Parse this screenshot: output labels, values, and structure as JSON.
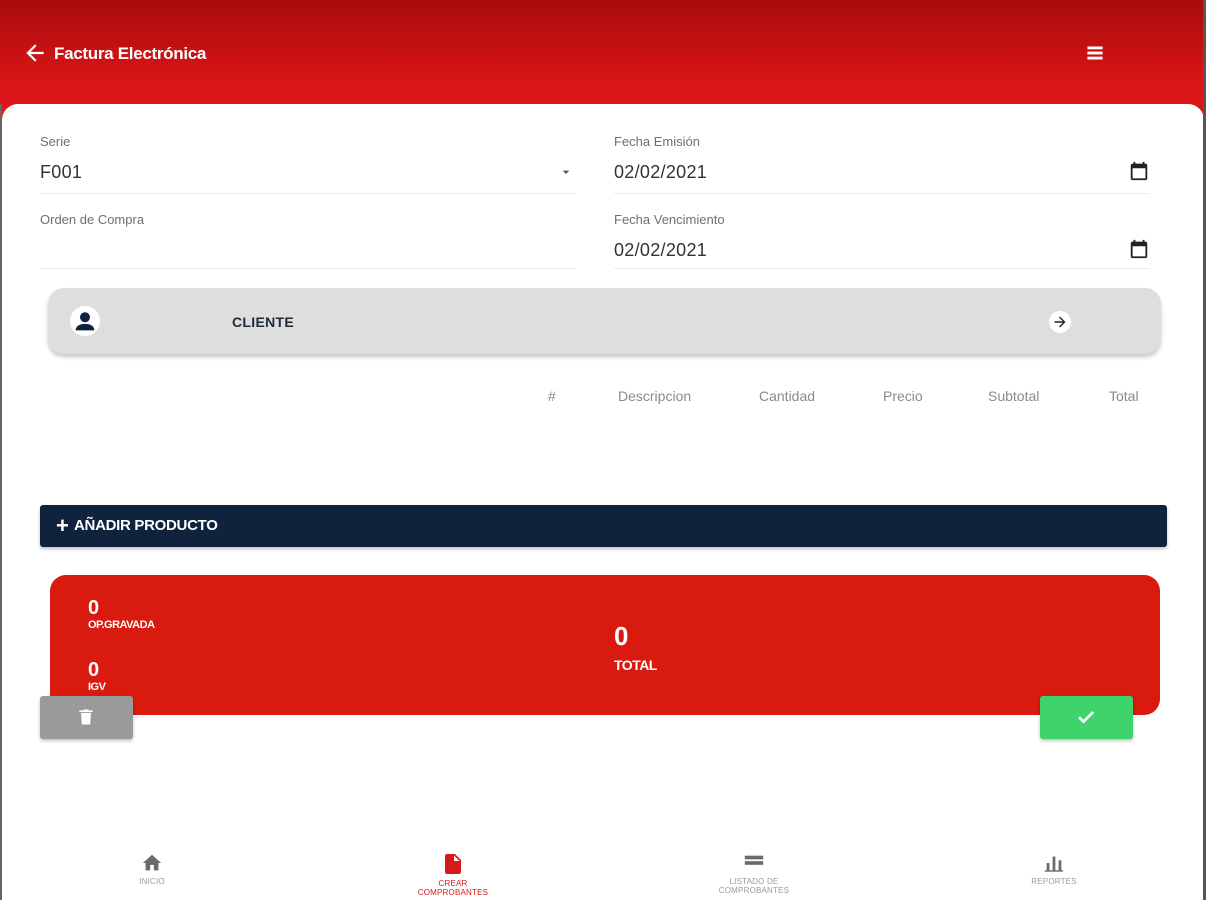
{
  "colors": {
    "header_red": "#d41416",
    "navy": "#0f233d",
    "totals_red": "#d81a0f",
    "confirm_green": "#3fd46b",
    "delete_gray": "#9a9a9a",
    "active_nav": "#d51a1a"
  },
  "header": {
    "title": "Factura Electrónica",
    "back_icon": "arrow-left-icon",
    "menu_icon": "hamburger-menu-icon"
  },
  "form": {
    "serie": {
      "label": "Serie",
      "value": "F001",
      "icon": "dropdown-caret-icon"
    },
    "fecha_emision": {
      "label": "Fecha Emisión",
      "value": "02/02/2021",
      "icon": "calendar-icon"
    },
    "orden_compra": {
      "label": "Orden de Compra",
      "value": ""
    },
    "fecha_vencimiento": {
      "label": "Fecha Vencimiento",
      "value": "02/02/2021",
      "icon": "calendar-icon"
    }
  },
  "cliente": {
    "label": "CLIENTE",
    "icon": "user-icon",
    "action_icon": "arrow-right-circle-icon"
  },
  "table": {
    "columns": [
      "#",
      "Descripcion",
      "Cantidad",
      "Precio",
      "Subtotal",
      "Total"
    ],
    "rows": []
  },
  "add_product": {
    "label": "AÑADIR PRODUCTO",
    "icon": "plus-icon"
  },
  "totals": {
    "op_gravada": {
      "value": "0",
      "label": "OP.GRAVADA"
    },
    "igv": {
      "value": "0",
      "label": "IGV"
    },
    "total": {
      "value": "0",
      "label": "TOTAL"
    }
  },
  "actions": {
    "delete_icon": "trash-icon",
    "confirm_icon": "check-icon"
  },
  "bottom_nav": [
    {
      "label": "INICIO",
      "icon": "home-icon",
      "active": false
    },
    {
      "label": "CREAR COMPROBANTES",
      "icon": "document-icon",
      "active": true
    },
    {
      "label": "LISTADO DE COMPROBANTES",
      "icon": "list-icon",
      "active": false
    },
    {
      "label": "REPORTES",
      "icon": "bar-chart-icon",
      "active": false
    }
  ]
}
